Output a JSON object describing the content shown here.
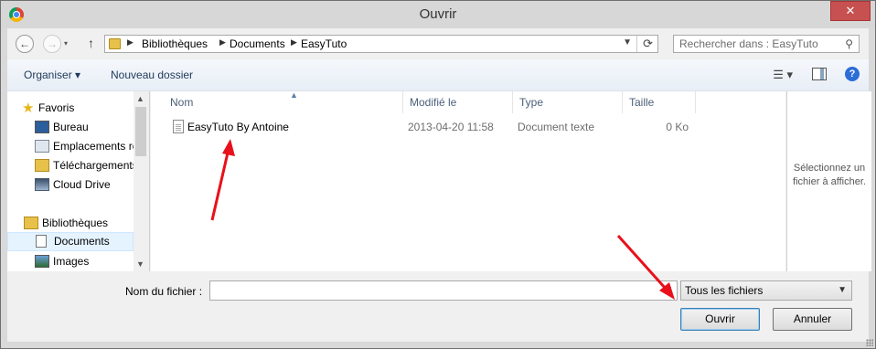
{
  "window": {
    "title": "Ouvrir",
    "close_glyph": "✕"
  },
  "nav": {
    "back_glyph": "←",
    "forward_glyph": "→",
    "up_glyph": "↑",
    "breadcrumbs": [
      "Bibliothèques",
      "Documents",
      "EasyTuto"
    ],
    "search_placeholder": "Rechercher dans : EasyTuto"
  },
  "toolbar": {
    "organise_label": "Organiser ▾",
    "new_folder_label": "Nouveau dossier",
    "view_glyph": "☰ ▾",
    "help_glyph": "?"
  },
  "sidebar": {
    "items": [
      {
        "label": "Favoris",
        "icon": "star-icon"
      },
      {
        "label": "Bureau",
        "icon": "desktop-icon"
      },
      {
        "label": "Emplacements ré",
        "icon": "recent-places-icon"
      },
      {
        "label": "Téléchargements",
        "icon": "downloads-icon"
      },
      {
        "label": "Cloud Drive",
        "icon": "cloud-drive-icon"
      },
      {
        "label": "Bibliothèques",
        "icon": "libraries-icon"
      },
      {
        "label": "Documents",
        "icon": "documents-icon",
        "selected": true
      },
      {
        "label": "Images",
        "icon": "images-icon"
      }
    ]
  },
  "file_list": {
    "columns": [
      "Nom",
      "Modifié le",
      "Type",
      "Taille"
    ],
    "rows": [
      {
        "name": "EasyTuto By Antoine",
        "modified": "2013-04-20 11:58",
        "type": "Document texte",
        "size": "0 Ko"
      }
    ]
  },
  "preview": {
    "text": "Sélectionnez un fichier à afficher."
  },
  "footer": {
    "filename_label": "Nom du fichier :",
    "filename_value": "",
    "filter_value": "Tous les fichiers",
    "open_label": "Ouvrir",
    "cancel_label": "Annuler"
  },
  "colors": {
    "annotation_arrow": "#e8101a",
    "accent": "#2c6dd6"
  }
}
